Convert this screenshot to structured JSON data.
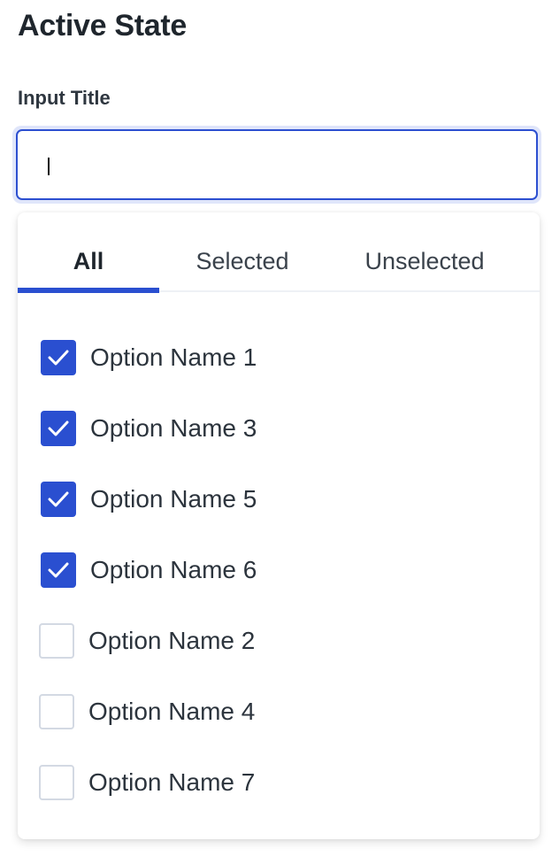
{
  "heading": "Active State",
  "input": {
    "label": "Input Title",
    "value": "",
    "focused": true
  },
  "colors": {
    "accent": "#2a4fd0",
    "focus_ring": "#dfe5fa",
    "text": "#2c343d"
  },
  "tabs": [
    {
      "label": "All",
      "active": true
    },
    {
      "label": "Selected",
      "active": false
    },
    {
      "label": "Unselected",
      "active": false
    }
  ],
  "options": [
    {
      "label": "Option Name 1",
      "checked": true
    },
    {
      "label": "Option Name 3",
      "checked": true
    },
    {
      "label": "Option Name 5",
      "checked": true
    },
    {
      "label": "Option Name 6",
      "checked": true
    },
    {
      "label": "Option Name 2",
      "checked": false
    },
    {
      "label": "Option Name 4",
      "checked": false
    },
    {
      "label": "Option Name 7",
      "checked": false
    }
  ]
}
